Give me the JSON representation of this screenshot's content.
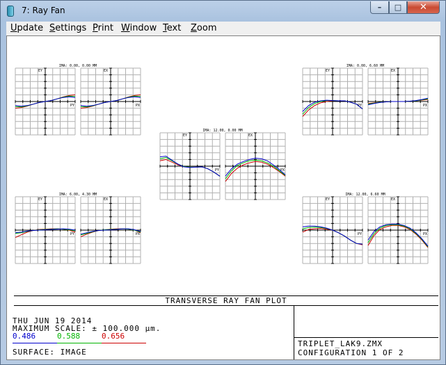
{
  "window": {
    "title": "7: Ray Fan",
    "minimize_glyph": "–",
    "maximize_glyph": "□",
    "close_glyph": "✕",
    "icon": "app-icon"
  },
  "menu": [
    {
      "first": "U",
      "rest": "pdate"
    },
    {
      "first": "S",
      "rest": "ettings"
    },
    {
      "first": "P",
      "rest": "rint"
    },
    {
      "first": "W",
      "rest": "indow"
    },
    {
      "first": "T",
      "rest": "ext"
    },
    {
      "first": "Z",
      "rest": "oom"
    }
  ],
  "footer": {
    "plot_title": "TRANSVERSE RAY FAN PLOT",
    "date": "THU JUN 19 2014",
    "max_scale": "MAXIMUM SCALE: ± 100.000 µm.",
    "wavelengths": [
      {
        "label": "0.486",
        "color": "#0000cc"
      },
      {
        "label": "0.588",
        "color": "#00b400"
      },
      {
        "label": "0.656",
        "color": "#cc0000"
      }
    ],
    "surface": "SURFACE: IMAGE",
    "file": "TRIPLET_LAK9.ZMX",
    "config": "CONFIGURATION 1 OF 2"
  },
  "chart_data": {
    "type": "line",
    "title": "TRANSVERSE RAY FAN PLOT",
    "x_range": [
      -1,
      1
    ],
    "y_range": [
      -100,
      100
    ],
    "y_unit": "µm",
    "grid": true,
    "pair_axis_labels": {
      "tangential_y": "EY",
      "tangential_x": "PY",
      "sagittal_y": "EX",
      "sagittal_x": "PX"
    },
    "fields": [
      {
        "label": "IMA: 0.00, 0.00 MM",
        "tangential": {
          "blue": [
            -12,
            -14,
            -12,
            -8,
            -3,
            0,
            3,
            8,
            12,
            14,
            12
          ],
          "green": [
            -15,
            -16,
            -13,
            -8,
            -3,
            0,
            3,
            8,
            13,
            16,
            15
          ],
          "red": [
            -20,
            -18,
            -14,
            -8,
            -3,
            0,
            3,
            8,
            14,
            18,
            20
          ]
        },
        "sagittal": {
          "blue": [
            -12,
            -14,
            -12,
            -8,
            -3,
            0,
            3,
            8,
            12,
            14,
            12
          ],
          "green": [
            -15,
            -16,
            -13,
            -8,
            -3,
            0,
            3,
            8,
            13,
            16,
            15
          ],
          "red": [
            -20,
            -18,
            -14,
            -8,
            -3,
            0,
            3,
            8,
            14,
            18,
            20
          ]
        }
      },
      {
        "label": "IMA: 0.00, 6.60 MM",
        "tangential": {
          "blue": [
            -30,
            -12,
            -2,
            2,
            4,
            3,
            2,
            2,
            -2,
            -8,
            -22
          ],
          "green": [
            -38,
            -18,
            -6,
            0,
            3,
            3,
            2,
            2,
            -2,
            -8,
            -22
          ],
          "red": [
            -45,
            -25,
            -12,
            -4,
            0,
            2,
            2,
            2,
            -2,
            -8,
            -22
          ]
        },
        "sagittal": {
          "blue": [
            -10,
            -6,
            -3,
            -1,
            0,
            0,
            0,
            1,
            3,
            6,
            10
          ],
          "green": [
            -8,
            -5,
            -2,
            -1,
            0,
            0,
            0,
            1,
            2,
            5,
            8
          ],
          "red": [
            -6,
            -4,
            -2,
            -1,
            0,
            0,
            0,
            1,
            2,
            4,
            6
          ]
        }
      },
      {
        "label": "IMA: 12.00, 0.00 MM",
        "tangential": {
          "blue": [
            28,
            30,
            18,
            6,
            -2,
            -4,
            -3,
            -2,
            -8,
            -18,
            -30
          ],
          "green": [
            22,
            26,
            16,
            6,
            -1,
            -3,
            -3,
            -2,
            -8,
            -18,
            -30
          ],
          "red": [
            16,
            20,
            12,
            4,
            -1,
            -3,
            -3,
            -2,
            -8,
            -18,
            -30
          ]
        },
        "sagittal": {
          "blue": [
            -30,
            -8,
            6,
            14,
            20,
            24,
            22,
            16,
            4,
            -10,
            -26
          ],
          "green": [
            -38,
            -14,
            2,
            10,
            16,
            18,
            16,
            10,
            0,
            -14,
            -28
          ],
          "red": [
            -46,
            -22,
            -6,
            4,
            10,
            14,
            12,
            6,
            -4,
            -16,
            -30
          ]
        }
      },
      {
        "label": "IMA: 6.00, 4.30 MM",
        "tangential": {
          "blue": [
            -8,
            -6,
            -3,
            -1,
            0,
            1,
            2,
            3,
            4,
            3,
            0
          ],
          "green": [
            -10,
            -8,
            -4,
            -1,
            1,
            2,
            3,
            4,
            3,
            1,
            -2
          ],
          "red": [
            -22,
            -14,
            -6,
            -1,
            2,
            3,
            4,
            4,
            3,
            0,
            -6
          ]
        },
        "sagittal": {
          "blue": [
            -12,
            -8,
            -4,
            -1,
            0,
            1,
            2,
            4,
            4,
            1,
            -4
          ],
          "green": [
            -14,
            -10,
            -5,
            -1,
            1,
            2,
            3,
            4,
            3,
            0,
            -6
          ],
          "red": [
            -20,
            -12,
            -6,
            -1,
            1,
            3,
            4,
            4,
            3,
            0,
            -8
          ]
        }
      },
      {
        "label": "IMA: 12.00, 6.60 MM",
        "tangential": {
          "blue": [
            10,
            12,
            12,
            10,
            6,
            0,
            -8,
            -18,
            -30,
            -40,
            -42
          ],
          "green": [
            4,
            8,
            9,
            8,
            5,
            0,
            -8,
            -18,
            -30,
            -40,
            -42
          ],
          "red": [
            -6,
            2,
            4,
            5,
            3,
            0,
            -8,
            -18,
            -30,
            -40,
            -44
          ]
        },
        "sagittal": {
          "blue": [
            -30,
            -4,
            10,
            16,
            18,
            18,
            14,
            6,
            -8,
            -26,
            -48
          ],
          "green": [
            -38,
            -10,
            6,
            14,
            16,
            16,
            12,
            4,
            -10,
            -28,
            -50
          ],
          "red": [
            -46,
            -16,
            2,
            10,
            14,
            14,
            10,
            2,
            -12,
            -30,
            -52
          ]
        }
      }
    ]
  }
}
